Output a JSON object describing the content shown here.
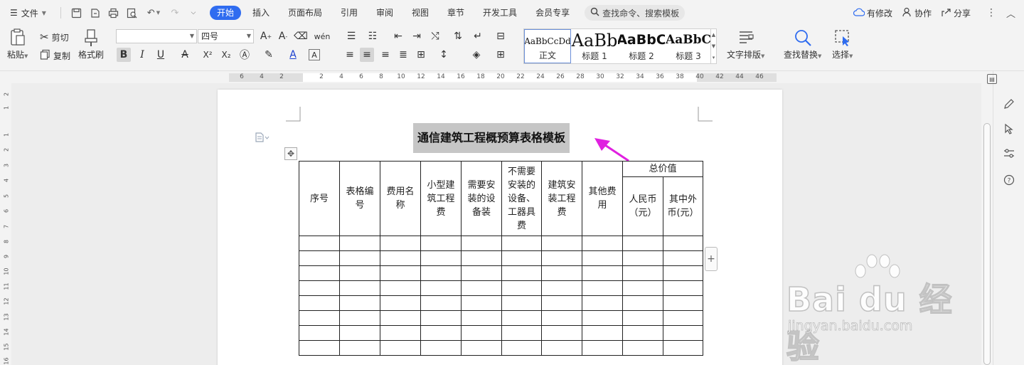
{
  "menubar": {
    "file_label": "文件",
    "tabs": [
      "开始",
      "插入",
      "页面布局",
      "引用",
      "审阅",
      "视图",
      "章节",
      "开发工具",
      "会员专享"
    ],
    "search_placeholder": "查找命令、搜索模板",
    "right_items": {
      "modified": "有修改",
      "collab": "协作",
      "share": "分享"
    }
  },
  "ribbon": {
    "paste": "粘贴",
    "cut": "剪切",
    "copy": "复制",
    "format_painter": "格式刷",
    "font_name": "",
    "font_size": "四号",
    "styles": [
      {
        "preview": "AaBbCcDd",
        "name": "正文"
      },
      {
        "preview": "AaBb",
        "name": "标题 1"
      },
      {
        "preview": "AaBbC",
        "name": "标题 2"
      },
      {
        "preview": "AaBbC",
        "name": "标题 3"
      }
    ],
    "text_layout": "文字排版",
    "find_replace": "查找替换",
    "select": "选择"
  },
  "ruler": {
    "h_numbers": [
      "6",
      "4",
      "2",
      "2",
      "4",
      "6",
      "8",
      "10",
      "12",
      "14",
      "16",
      "18",
      "20",
      "22",
      "24",
      "26",
      "28",
      "30",
      "32",
      "34",
      "36",
      "38",
      "40",
      "42",
      "44",
      "46"
    ],
    "v_numbers": [
      "2",
      "1",
      "1",
      "2",
      "3",
      "4",
      "5",
      "6",
      "7",
      "8",
      "9",
      "10",
      "11",
      "12",
      "13",
      "14",
      "15",
      "16"
    ]
  },
  "document": {
    "title": "通信建筑工程概预算表格模板",
    "table": {
      "headers": [
        "序号",
        "表格编号",
        "费用名称",
        "小型建筑工程费",
        "需要安装的设备装",
        "不需要安装的设备、工器具费",
        "建筑安装工程费",
        "其他费用"
      ],
      "group_header": "总价值",
      "sub_headers": [
        "人民币（元）",
        "其中外币(元）"
      ],
      "empty_rows": 8
    }
  },
  "watermark": {
    "brand": "Bai du 经验",
    "url": "jingyan.baidu.com"
  },
  "colors": {
    "accent": "#2f6cf0",
    "arrow": "#e020e0",
    "title_highlight": "#c6c6c6"
  }
}
